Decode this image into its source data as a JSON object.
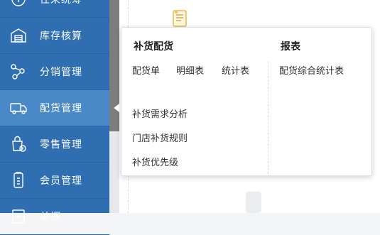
{
  "sidebar": {
    "items": [
      {
        "label": "往来统筹",
        "icon": "coins-icon"
      },
      {
        "label": "库存核算",
        "icon": "warehouse-icon"
      },
      {
        "label": "分销管理",
        "icon": "distribution-icon"
      },
      {
        "label": "配货管理",
        "icon": "truck-icon",
        "active": true
      },
      {
        "label": "零售管理",
        "icon": "retail-bag-icon"
      },
      {
        "label": "会员管理",
        "icon": "member-icon"
      },
      {
        "label": "单据",
        "icon": "document-icon"
      }
    ]
  },
  "popup": {
    "section_replenish": {
      "title": "补货配货",
      "links_row": [
        "配货单",
        "明细表",
        "统计表"
      ],
      "links_col": [
        "补货需求分析",
        "门店补货规则",
        "补货优先级"
      ]
    },
    "section_report": {
      "title": "报表",
      "links": [
        "配货综合统计表"
      ]
    }
  },
  "colors": {
    "sidebar_bg": "#2f6fb1",
    "sidebar_active": "#4a89c8",
    "popup_bg": "#ffffff"
  }
}
